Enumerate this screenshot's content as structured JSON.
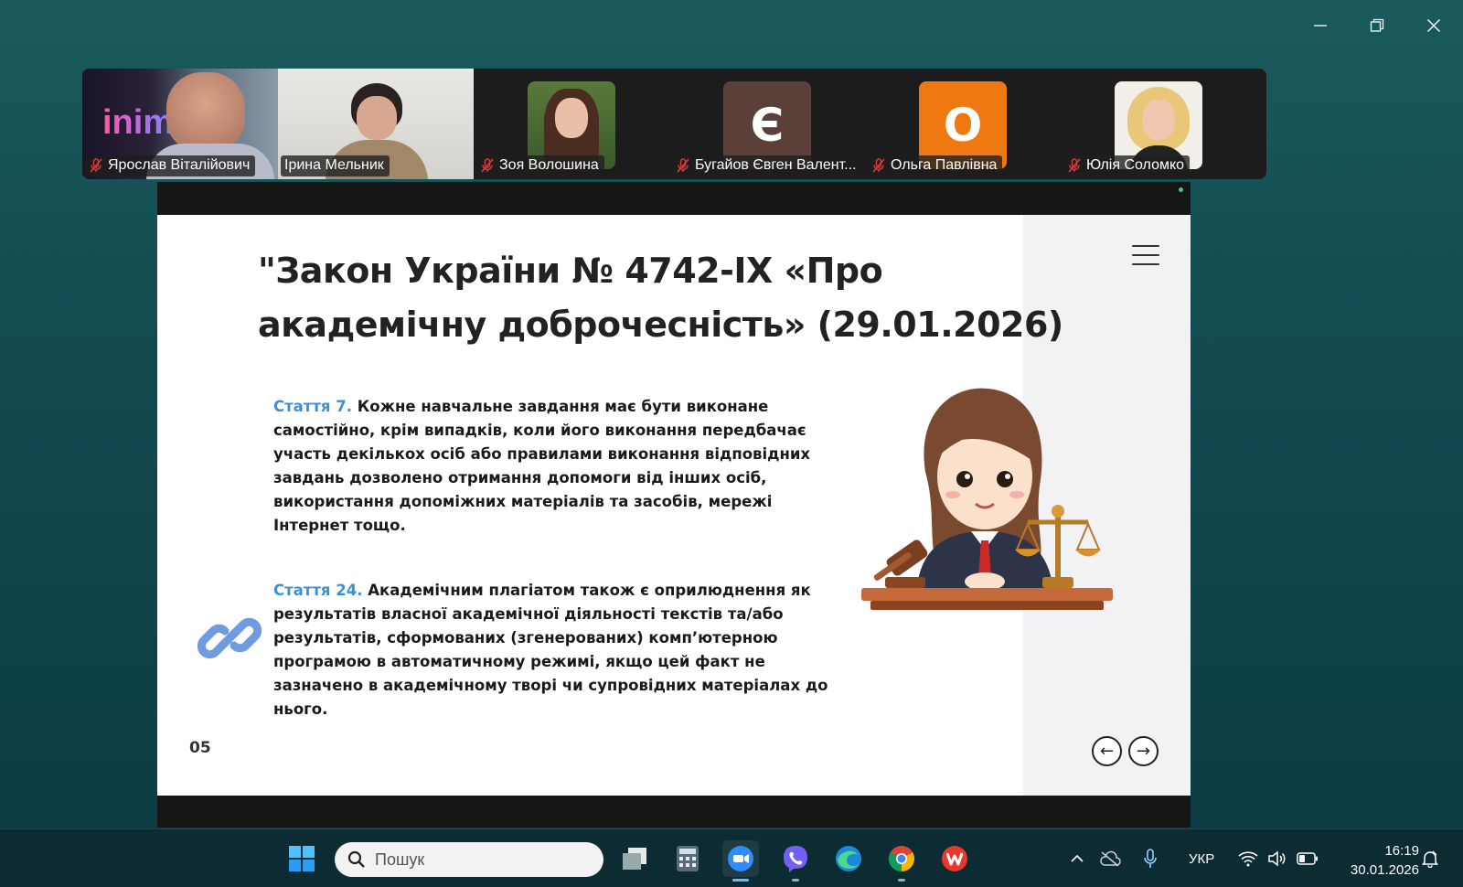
{
  "participants": [
    {
      "name": "Ярослав Віталійович",
      "muted": true,
      "video_text": "inims"
    },
    {
      "name": "Ірина Мельник",
      "muted": false,
      "active": true
    },
    {
      "name": "Зоя Волошина",
      "muted": true
    },
    {
      "name": "Бугайов Євген Валент...",
      "muted": true,
      "avatar_letter": "Є",
      "avatar_color": "#5a4038"
    },
    {
      "name": "Ольга Павлівна",
      "muted": true,
      "avatar_letter": "О",
      "avatar_color": "#f07810"
    },
    {
      "name": "Юлія Соломко",
      "muted": true
    }
  ],
  "slide": {
    "title": "\"Закон України № 4742-IX «Про академічну доброчесність» (29.01.2026)",
    "article7_lead": "Стаття 7.",
    "article7_text": " Кожне навчальне завдання має бути виконане самостійно, крім випадків, коли його виконання передбачає участь декількох осіб або правилами виконання відповідних завдань дозволено отримання допомоги від інших осіб, використання допоміжних матеріалів та засобів, мережі Інтернет тощо.",
    "article24_lead": "Стаття 24.",
    "article24_text": " Академічним плагіатом також є оприлюднення як результатів власної академічної діяльності текстів та/або результатів, сформованих (згенерованих) комп’ютерною програмою в автоматичному режимі, якщо цей факт не зазначено в академічному творі чи супровідних матеріалах до нього.",
    "page_number": "05",
    "prev_arrow": "←",
    "next_arrow": "→"
  },
  "taskbar": {
    "search_placeholder": "Пошук",
    "language": "УКР",
    "time": "16:19",
    "date": "30.01.2026"
  },
  "colors": {
    "accent_blue": "#3d8fd6",
    "active_speaker": "#2fd38a"
  }
}
